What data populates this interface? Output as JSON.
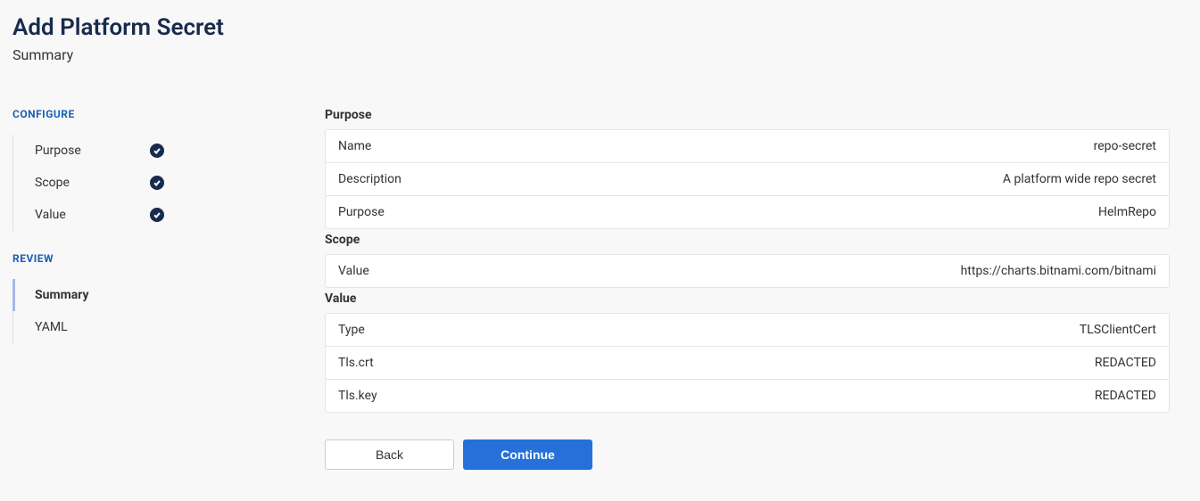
{
  "header": {
    "title": "Add Platform Secret",
    "subtitle": "Summary"
  },
  "sidebar": {
    "configure": {
      "header": "CONFIGURE",
      "items": [
        {
          "label": "Purpose",
          "done": true
        },
        {
          "label": "Scope",
          "done": true
        },
        {
          "label": "Value",
          "done": true
        }
      ]
    },
    "review": {
      "header": "REVIEW",
      "items": [
        {
          "label": "Summary",
          "active": true
        },
        {
          "label": "YAML",
          "active": false
        }
      ]
    }
  },
  "summary": {
    "purpose": {
      "title": "Purpose",
      "rows": [
        {
          "key": "Name",
          "value": "repo-secret"
        },
        {
          "key": "Description",
          "value": "A platform wide repo secret"
        },
        {
          "key": "Purpose",
          "value": "HelmRepo"
        }
      ]
    },
    "scope": {
      "title": "Scope",
      "rows": [
        {
          "key": "Value",
          "value": "https://charts.bitnami.com/bitnami"
        }
      ]
    },
    "value": {
      "title": "Value",
      "rows": [
        {
          "key": "Type",
          "value": "TLSClientCert"
        },
        {
          "key": "Tls.crt",
          "value": "REDACTED"
        },
        {
          "key": "Tls.key",
          "value": "REDACTED"
        }
      ]
    }
  },
  "buttons": {
    "back": "Back",
    "continue": "Continue"
  }
}
